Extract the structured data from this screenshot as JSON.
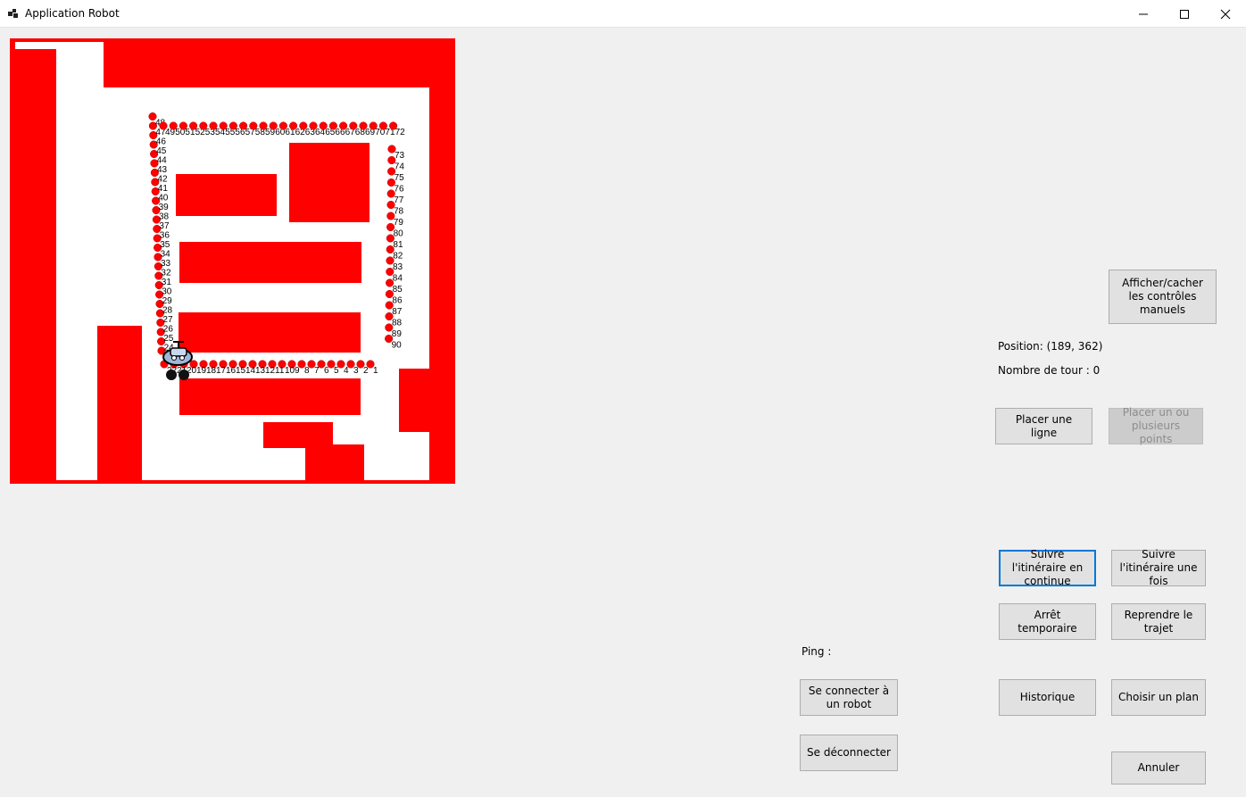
{
  "window": {
    "title": "Application Robot",
    "minimize_glyph": "—",
    "maximize_glyph": "☐",
    "close_glyph": "✕"
  },
  "map": {
    "wall_color": "#ff0000",
    "floor_color": "#ffffff",
    "waypoint_color": "#ff0000",
    "waypoint_count": 90,
    "robot_icon": "robot-car-icon"
  },
  "status": {
    "position": "Position: (189, 362)",
    "laps": "Nombre de tour : 0",
    "ping": "Ping :"
  },
  "buttons": {
    "toggle_manual": "Afficher/cacher les contrôles manuels",
    "place_line": "Placer une ligne",
    "place_points": "Placer un ou plusieurs points",
    "follow_continuous": "Suivre l'itinéraire en continue",
    "follow_once": "Suivre l'itinéraire une fois",
    "pause": "Arrêt temporaire",
    "resume": "Reprendre le trajet",
    "connect": "Se connecter à un robot",
    "disconnect": "Se déconnecter",
    "history": "Historique",
    "choose_plan": "Choisir un plan",
    "cancel": "Annuler"
  },
  "accent_color": "#0078d7"
}
